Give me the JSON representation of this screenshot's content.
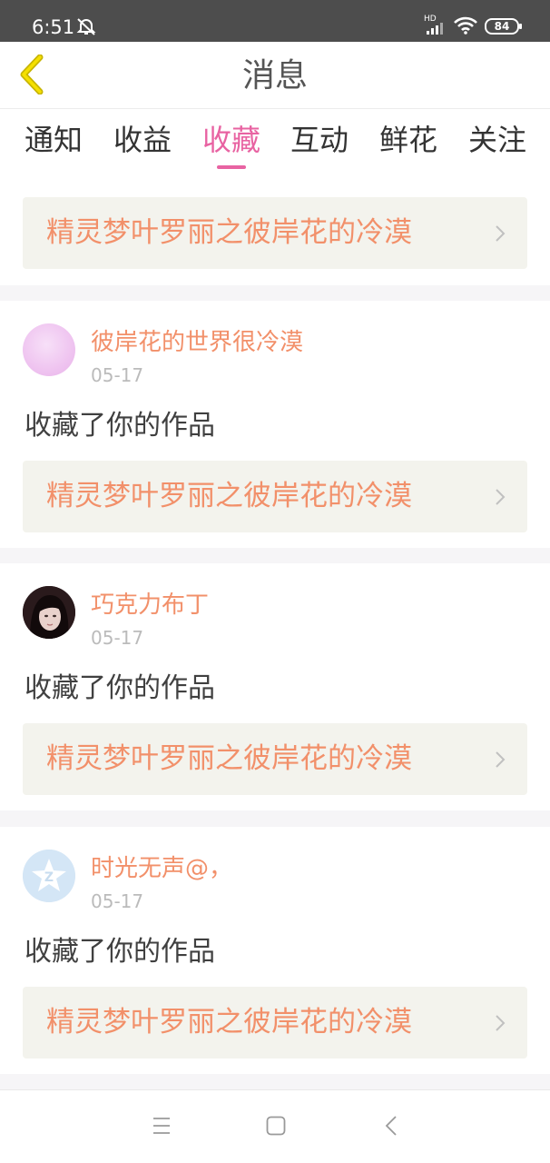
{
  "status_bar": {
    "time": "6:51",
    "network_label": "HD",
    "battery": "84",
    "icons": [
      "alarm-off-icon",
      "signal-icon",
      "wifi-icon",
      "battery-icon"
    ]
  },
  "header": {
    "title": "消息",
    "back_icon": "chevron-left-icon"
  },
  "tabs": [
    {
      "label": "通知",
      "active": false
    },
    {
      "label": "收益",
      "active": false
    },
    {
      "label": "收藏",
      "active": true
    },
    {
      "label": "互动",
      "active": false
    },
    {
      "label": "鲜花",
      "active": false
    },
    {
      "label": "关注",
      "active": false
    }
  ],
  "colors": {
    "accent": "#e863a2",
    "name": "#f2906a",
    "status_bar": "#4d4d4d",
    "work_box": "#f3f3ed"
  },
  "notifications": [
    {
      "work": "精灵梦叶罗丽之彼岸花的冷漠"
    },
    {
      "user": "彼岸花的世界很冷漠",
      "date": "05-17",
      "action": "收藏了你的作品",
      "work": "精灵梦叶罗丽之彼岸花的冷漠"
    },
    {
      "user": "巧克力布丁",
      "date": "05-17",
      "action": "收藏了你的作品",
      "work": "精灵梦叶罗丽之彼岸花的冷漠"
    },
    {
      "user": "时光无声@，",
      "date": "05-17",
      "action": "收藏了你的作品",
      "work": "精灵梦叶罗丽之彼岸花的冷漠"
    }
  ],
  "nav_bar": {
    "icons": [
      "menu-icon",
      "home-icon",
      "back-icon"
    ]
  }
}
